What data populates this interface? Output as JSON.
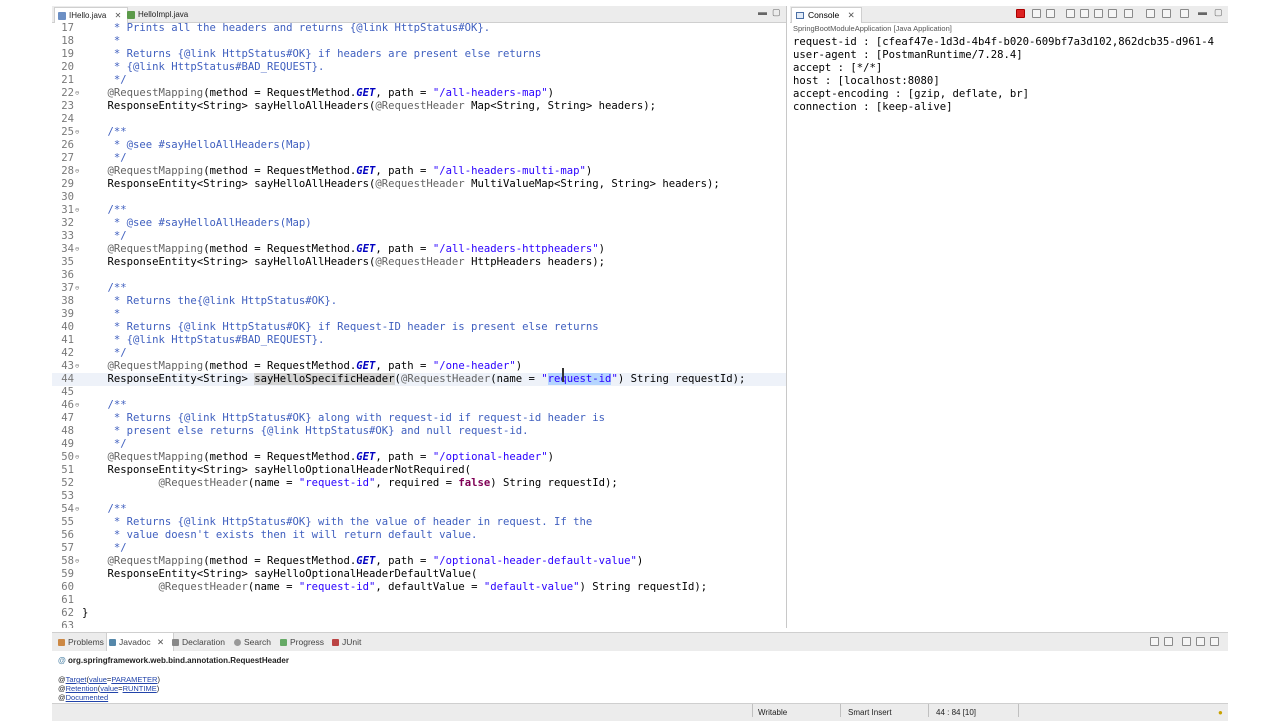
{
  "editor": {
    "tabs": [
      {
        "label": "IHello.java",
        "active": true
      },
      {
        "label": "HelloImpl.java",
        "active": false
      }
    ],
    "lines": [
      {
        "n": "17",
        "html": "<span class=\"cm\">     * Prints all the headers and returns {@link HttpStatus#OK}.</span>"
      },
      {
        "n": "18",
        "html": "<span class=\"cm\">     *</span>"
      },
      {
        "n": "19",
        "html": "<span class=\"cm\">     * Returns {@link HttpStatus#OK} if headers are present else returns</span>"
      },
      {
        "n": "20",
        "html": "<span class=\"cm\">     * {@link HttpStatus#BAD_REQUEST}.</span>"
      },
      {
        "n": "21",
        "html": "<span class=\"cm\">     */</span>"
      },
      {
        "n": "22",
        "fold": true,
        "html": "    <span class=\"an\">@RequestMapping</span>(method = RequestMethod.<span class=\"it\">GET</span>, path = <span class=\"st\">\"/all-headers-map\"</span>)"
      },
      {
        "n": "23",
        "html": "    ResponseEntity&lt;String&gt; sayHelloAllHeaders(<span class=\"an\">@RequestHeader</span> Map&lt;String, String&gt; headers);"
      },
      {
        "n": "24",
        "html": ""
      },
      {
        "n": "25",
        "fold": true,
        "html": "<span class=\"cm\">    /**</span>"
      },
      {
        "n": "26",
        "html": "<span class=\"cm\">     * @see #sayHelloAllHeaders(Map)</span>"
      },
      {
        "n": "27",
        "html": "<span class=\"cm\">     */</span>"
      },
      {
        "n": "28",
        "fold": true,
        "html": "    <span class=\"an\">@RequestMapping</span>(method = RequestMethod.<span class=\"it\">GET</span>, path = <span class=\"st\">\"/all-headers-multi-map\"</span>)"
      },
      {
        "n": "29",
        "html": "    ResponseEntity&lt;String&gt; sayHelloAllHeaders(<span class=\"an\">@RequestHeader</span> MultiValueMap&lt;String, String&gt; headers);"
      },
      {
        "n": "30",
        "html": ""
      },
      {
        "n": "31",
        "fold": true,
        "html": "<span class=\"cm\">    /**</span>"
      },
      {
        "n": "32",
        "html": "<span class=\"cm\">     * @see #sayHelloAllHeaders(Map)</span>"
      },
      {
        "n": "33",
        "html": "<span class=\"cm\">     */</span>"
      },
      {
        "n": "34",
        "fold": true,
        "html": "    <span class=\"an\">@RequestMapping</span>(method = RequestMethod.<span class=\"it\">GET</span>, path = <span class=\"st\">\"/all-headers-httpheaders\"</span>)"
      },
      {
        "n": "35",
        "html": "    ResponseEntity&lt;String&gt; sayHelloAllHeaders(<span class=\"an\">@RequestHeader</span> HttpHeaders headers);"
      },
      {
        "n": "36",
        "html": ""
      },
      {
        "n": "37",
        "fold": true,
        "html": "<span class=\"cm\">    /**</span>"
      },
      {
        "n": "38",
        "html": "<span class=\"cm\">     * Returns the{@link HttpStatus#OK}.</span>"
      },
      {
        "n": "39",
        "html": "<span class=\"cm\">     *</span>"
      },
      {
        "n": "40",
        "html": "<span class=\"cm\">     * Returns {@link HttpStatus#OK} if Request-ID header is present else returns</span>"
      },
      {
        "n": "41",
        "html": "<span class=\"cm\">     * {@link HttpStatus#BAD_REQUEST}.</span>"
      },
      {
        "n": "42",
        "html": "<span class=\"cm\">     */</span>"
      },
      {
        "n": "43",
        "fold": true,
        "html": "    <span class=\"an\">@RequestMapping</span>(method = RequestMethod.<span class=\"it\">GET</span>, path = <span class=\"st\">\"/one-header\"</span>)"
      },
      {
        "n": "44",
        "current": true,
        "html": "    ResponseEntity&lt;String&gt; <span class=\"hl\">sayHelloSpecificHeader</span>(<span class=\"an\">@RequestHeader</span>(name = <span class=\"st\">\"<span class=\"sel\">request-id</span>\"</span>) String requestId);"
      },
      {
        "n": "45",
        "html": ""
      },
      {
        "n": "46",
        "fold": true,
        "html": "<span class=\"cm\">    /**</span>"
      },
      {
        "n": "47",
        "html": "<span class=\"cm\">     * Returns {@link HttpStatus#OK} along with request-id if request-id header is</span>"
      },
      {
        "n": "48",
        "html": "<span class=\"cm\">     * present else returns {@link HttpStatus#OK} and null request-id.</span>"
      },
      {
        "n": "49",
        "html": "<span class=\"cm\">     */</span>"
      },
      {
        "n": "50",
        "fold": true,
        "html": "    <span class=\"an\">@RequestMapping</span>(method = RequestMethod.<span class=\"it\">GET</span>, path = <span class=\"st\">\"/optional-header\"</span>)"
      },
      {
        "n": "51",
        "html": "    ResponseEntity&lt;String&gt; sayHelloOptionalHeaderNotRequired("
      },
      {
        "n": "52",
        "html": "            <span class=\"an\">@RequestHeader</span>(name = <span class=\"st\">\"request-id\"</span>, required = <span class=\"kw\">false</span>) String requestId);"
      },
      {
        "n": "53",
        "html": ""
      },
      {
        "n": "54",
        "fold": true,
        "html": "<span class=\"cm\">    /**</span>"
      },
      {
        "n": "55",
        "html": "<span class=\"cm\">     * Returns {@link HttpStatus#OK} with the value of header in request. If the</span>"
      },
      {
        "n": "56",
        "html": "<span class=\"cm\">     * value doesn't exists then it will return default value.</span>"
      },
      {
        "n": "57",
        "html": "<span class=\"cm\">     */</span>"
      },
      {
        "n": "58",
        "fold": true,
        "html": "    <span class=\"an\">@RequestMapping</span>(method = RequestMethod.<span class=\"it\">GET</span>, path = <span class=\"st\">\"/optional-header-default-value\"</span>)"
      },
      {
        "n": "59",
        "html": "    ResponseEntity&lt;String&gt; sayHelloOptionalHeaderDefaultValue("
      },
      {
        "n": "60",
        "html": "            <span class=\"an\">@RequestHeader</span>(name = <span class=\"st\">\"request-id\"</span>, defaultValue = <span class=\"st\">\"default-value\"</span>) String requestId);"
      },
      {
        "n": "61",
        "html": ""
      },
      {
        "n": "62",
        "html": "}"
      },
      {
        "n": "63",
        "html": ""
      }
    ]
  },
  "console": {
    "tab_label": "Console",
    "title": "SpringBootModuleApplication [Java Application]",
    "lines": [
      "request-id : [cfeaf47e-1d3d-4b4f-b020-609bf7a3d102,862dcb35-d961-4",
      "user-agent : [PostmanRuntime/7.28.4]",
      "accept : [*/*]",
      "host : [localhost:8080]",
      "accept-encoding : [gzip, deflate, br]",
      "connection : [keep-alive]"
    ]
  },
  "bottom": {
    "tabs": [
      "Problems",
      "Javadoc",
      "Declaration",
      "Search",
      "Progress",
      "JUnit"
    ],
    "javadoc_header": "org.springframework.web.bind.annotation.RequestHeader",
    "javadoc_lines": [
      {
        "prefix": "@",
        "link1": "Target",
        "mid": "(",
        "link2": "value",
        "eq": "=",
        "link3": "PARAMETER",
        "end": ")"
      },
      {
        "prefix": "@",
        "link1": "Retention",
        "mid": "(",
        "link2": "value",
        "eq": "=",
        "link3": "RUNTIME",
        "end": ")"
      },
      {
        "prefix": "@",
        "link1": "Documented",
        "mid": "",
        "link2": "",
        "eq": "",
        "link3": "",
        "end": ""
      }
    ]
  },
  "status": {
    "writable": "Writable",
    "insert_mode": "Smart Insert",
    "position": "44 : 84 [10]"
  }
}
